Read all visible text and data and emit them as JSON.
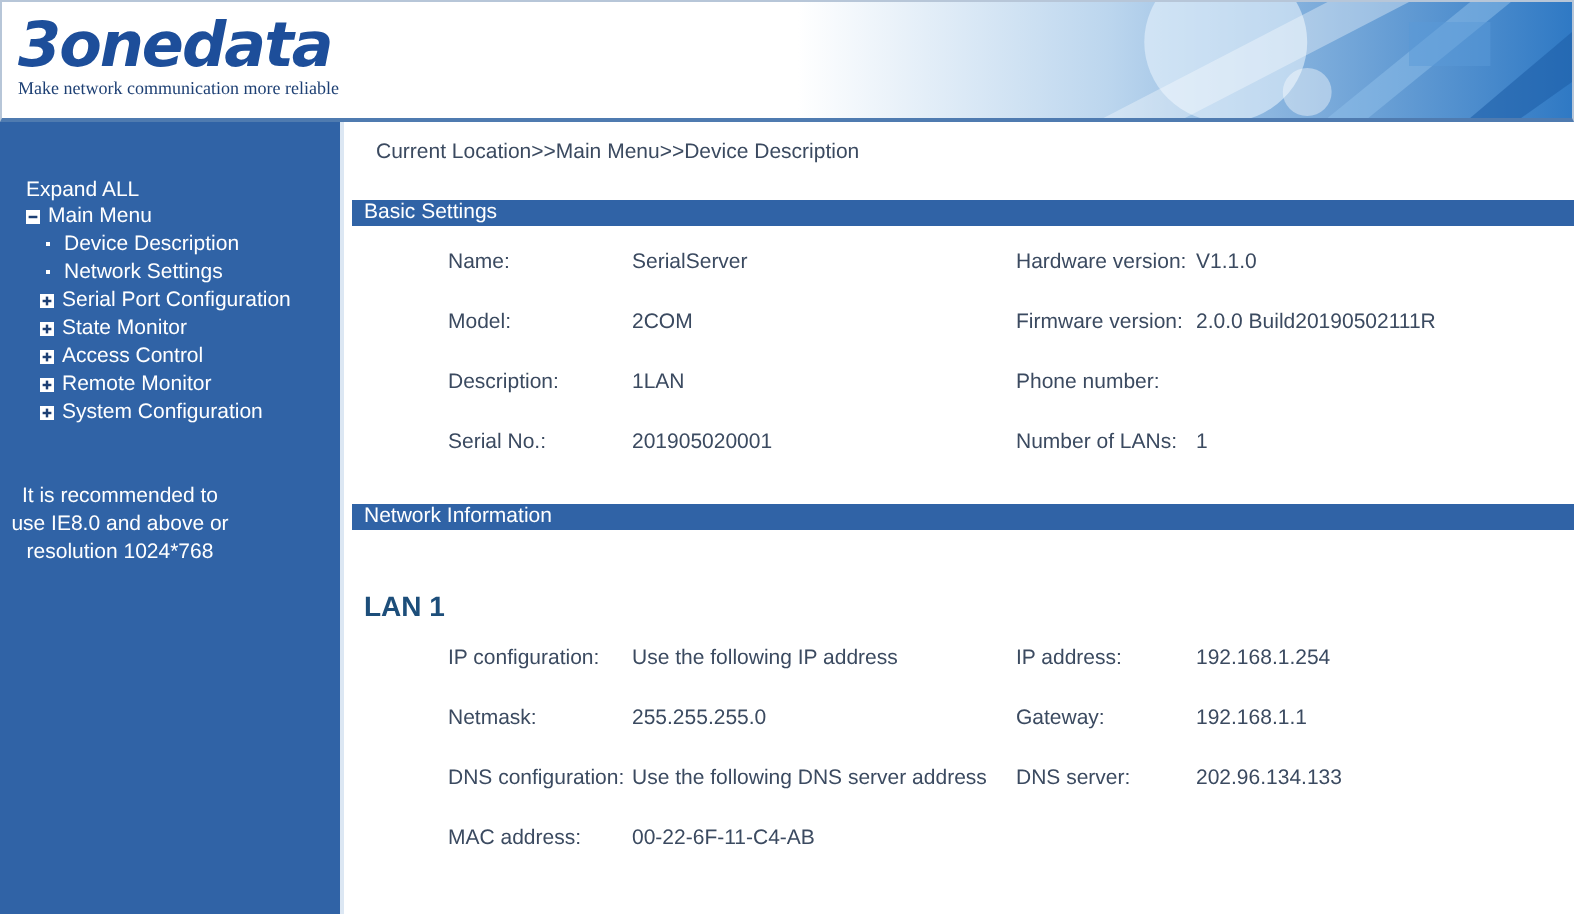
{
  "header": {
    "logo": "3onedata",
    "slogan": "Make network communication more reliable"
  },
  "sidebar": {
    "expand_all": "Expand ALL",
    "tree": [
      {
        "label": "Main Menu",
        "expanded": true,
        "children": [
          {
            "label": "Device Description"
          },
          {
            "label": "Network Settings"
          },
          {
            "label": "Serial Port Configuration",
            "expanded": false
          },
          {
            "label": "State Monitor",
            "expanded": false
          },
          {
            "label": "Access Control",
            "expanded": false
          },
          {
            "label": "Remote Monitor",
            "expanded": false
          },
          {
            "label": "System Configuration",
            "expanded": false
          }
        ]
      }
    ],
    "note": [
      "It is recommended to",
      "use IE8.0 and above or",
      "resolution 1024*768"
    ]
  },
  "breadcrumb": "Current Location>>Main Menu>>Device Description",
  "sections": [
    {
      "title": "Basic Settings",
      "rows": [
        [
          {
            "label": "Name:",
            "value": "SerialServer"
          },
          {
            "label": "Hardware version:",
            "value": "V1.1.0"
          }
        ],
        [
          {
            "label": "Model:",
            "value": "2COM"
          },
          {
            "label": "Firmware version:",
            "value": "2.0.0 Build20190502111R"
          }
        ],
        [
          {
            "label": "Description:",
            "value": "1LAN"
          },
          {
            "label": "Phone number:"
          }
        ],
        [
          {
            "label": "Serial No.:",
            "value": "201905020001"
          },
          {
            "label": "Number of LANs:",
            "value": "1"
          }
        ]
      ]
    },
    {
      "title": "Network Information",
      "subtitle": "LAN 1",
      "rows": [
        [
          {
            "label": "IP configuration:",
            "value": "Use the following IP address"
          },
          {
            "label": "IP address:",
            "value": "192.168.1.254"
          }
        ],
        [
          {
            "label": "Netmask:",
            "value": "255.255.255.0"
          },
          {
            "label": "Gateway:",
            "value": "192.168.1.1"
          }
        ],
        [
          {
            "label": "DNS configuration:",
            "value": "Use the following DNS server address"
          },
          {
            "label": "DNS server:",
            "value": "202.96.134.133"
          }
        ],
        [
          {
            "label": "MAC address:",
            "value": "00-22-6F-11-C4-AB"
          }
        ]
      ]
    }
  ]
}
